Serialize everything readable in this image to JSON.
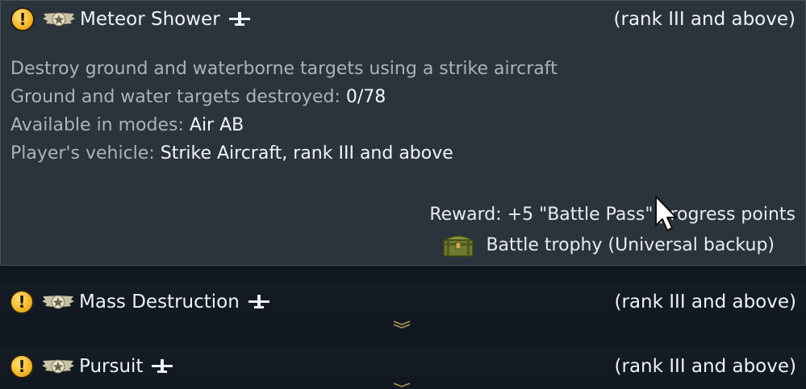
{
  "tasks": [
    {
      "title": "Meteor Shower",
      "rank": "(rank III and above)",
      "expanded": true,
      "description": "Destroy ground and waterborne targets using a strike aircraft",
      "progress_label": "Ground and water targets destroyed:",
      "progress_value": "0/78",
      "modes_label": "Available in modes:",
      "modes_value": "Air AB",
      "vehicle_label": "Player's vehicle:",
      "vehicle_value": "Strike Aircraft, rank III and above",
      "reward_text": "Reward: +5 \"Battle Pass\" progress points",
      "reward_item": "Battle trophy (Universal backup)"
    },
    {
      "title": "Mass Destruction",
      "rank": "(rank III and above)",
      "expanded": false
    },
    {
      "title": "Pursuit",
      "rank": "(rank III and above)",
      "expanded": false
    }
  ],
  "icons": {
    "warning": "exclamation-icon",
    "wings": "winged-star-icon",
    "plane": "aircraft-icon",
    "chest": "trophy-chest-icon",
    "expand": "chevron-down-icon"
  },
  "colors": {
    "panel": "#2b343d",
    "background": "#111821",
    "warning": "#f0b52a"
  }
}
